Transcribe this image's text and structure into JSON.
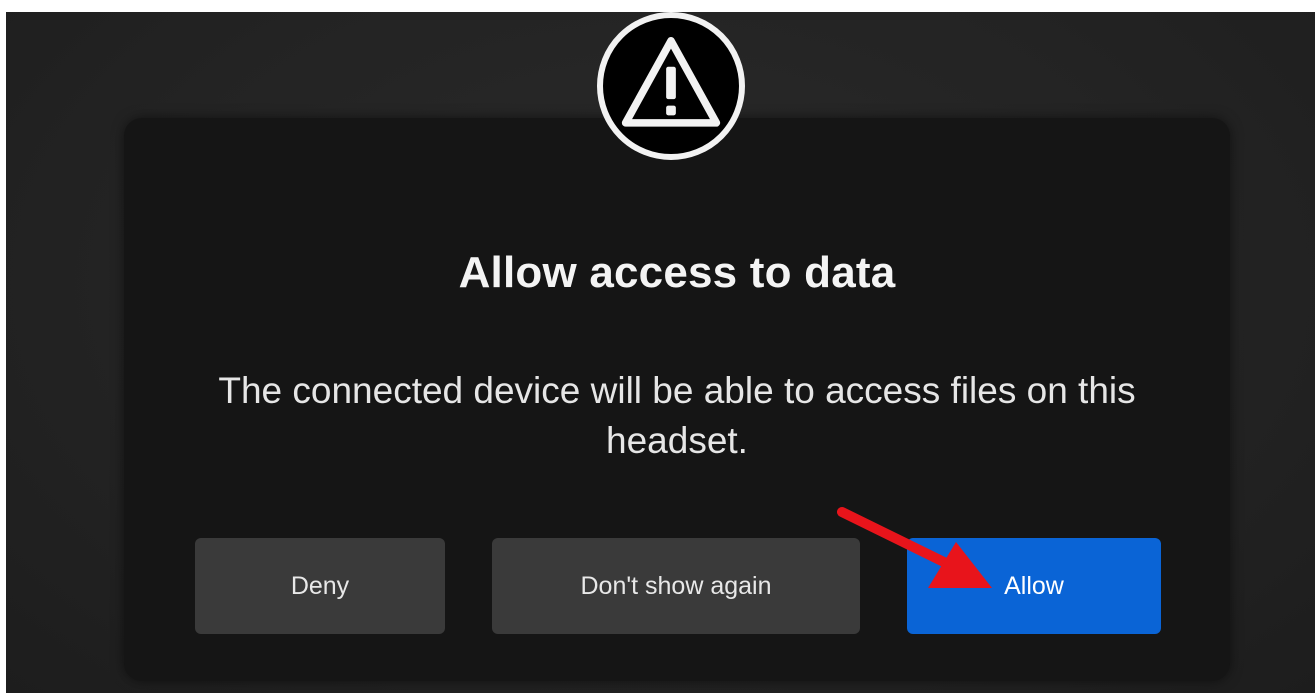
{
  "dialog": {
    "icon": "warning-triangle-icon",
    "title": "Allow access to data",
    "message": "The connected device will be able to access files on this headset."
  },
  "buttons": {
    "deny_label": "Deny",
    "dont_show_label": "Don't show again",
    "allow_label": "Allow"
  },
  "annotation": {
    "arrow_icon": "red-arrow-icon",
    "arrow_color": "#e8141b"
  },
  "colors": {
    "panel": "#151515",
    "background": "#232323",
    "secondary_button": "#3a3a3a",
    "primary_button": "#0a64d6"
  }
}
